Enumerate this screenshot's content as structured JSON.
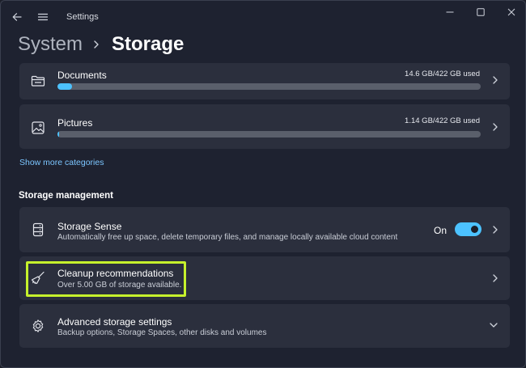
{
  "window": {
    "title": "Settings"
  },
  "breadcrumb": {
    "parent": "System",
    "current": "Storage"
  },
  "categories": [
    {
      "name": "Documents",
      "usage": "14.6 GB/422 GB used",
      "fraction": 0.035,
      "icon": "folder-icon"
    },
    {
      "name": "Pictures",
      "usage": "1.14 GB/422 GB used",
      "fraction": 0.003,
      "icon": "picture-icon"
    }
  ],
  "show_more_label": "Show more categories",
  "storage_management": {
    "heading": "Storage management",
    "storage_sense": {
      "title": "Storage Sense",
      "description": "Automatically free up space, delete temporary files, and manage locally available cloud content",
      "state_label": "On",
      "enabled": true
    },
    "cleanup": {
      "title": "Cleanup recommendations",
      "description": "Over 5.00 GB of storage available."
    },
    "advanced": {
      "title": "Advanced storage settings",
      "description": "Backup options, Storage Spaces, other disks and volumes"
    }
  },
  "colors": {
    "accent": "#4cc2ff",
    "highlight": "#c6f12c",
    "card": "#2b2f3d",
    "background": "#1e2230"
  }
}
